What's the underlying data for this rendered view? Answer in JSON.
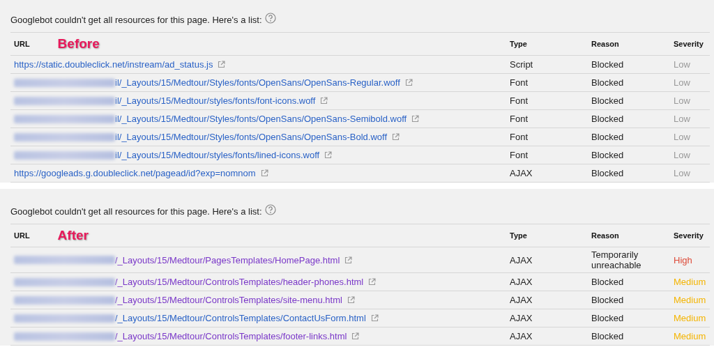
{
  "panels": [
    {
      "intro": "Googlebot couldn't get all resources for this page. Here's a list:",
      "annotation": "Before",
      "columns": [
        "URL",
        "Type",
        "Reason",
        "Severity"
      ],
      "rows": [
        {
          "redacted": false,
          "url": "https://static.doubleclick.net/instream/ad_status.js",
          "visited": false,
          "type": "Script",
          "reason": "Blocked",
          "severity": "Low",
          "color": "#999999"
        },
        {
          "redacted": true,
          "url": "il/_Layouts/15/Medtour/Styles/fonts/OpenSans/OpenSans-Regular.woff",
          "visited": false,
          "type": "Font",
          "reason": "Blocked",
          "severity": "Low",
          "color": "#999999"
        },
        {
          "redacted": true,
          "url": "il/_Layouts/15/Medtour/styles/fonts/font-icons.woff",
          "visited": false,
          "type": "Font",
          "reason": "Blocked",
          "severity": "Low",
          "color": "#999999"
        },
        {
          "redacted": true,
          "url": "il/_Layouts/15/Medtour/Styles/fonts/OpenSans/OpenSans-Semibold.woff",
          "visited": false,
          "type": "Font",
          "reason": "Blocked",
          "severity": "Low",
          "color": "#999999"
        },
        {
          "redacted": true,
          "url": "il/_Layouts/15/Medtour/Styles/fonts/OpenSans/OpenSans-Bold.woff",
          "visited": false,
          "type": "Font",
          "reason": "Blocked",
          "severity": "Low",
          "color": "#999999"
        },
        {
          "redacted": true,
          "url": "il/_Layouts/15/Medtour/styles/fonts/lined-icons.woff",
          "visited": false,
          "type": "Font",
          "reason": "Blocked",
          "severity": "Low",
          "color": "#999999"
        },
        {
          "redacted": false,
          "url": "https://googleads.g.doubleclick.net/pagead/id?exp=nomnom",
          "visited": false,
          "type": "AJAX",
          "reason": "Blocked",
          "severity": "Low",
          "color": "#999999"
        }
      ]
    },
    {
      "intro": "Googlebot couldn't get all resources for this page. Here's a list:",
      "annotation": "After",
      "columns": [
        "URL",
        "Type",
        "Reason",
        "Severity"
      ],
      "rows": [
        {
          "redacted": true,
          "url": "/_Layouts/15/Medtour/PagesTemplates/HomePage.html",
          "visited": true,
          "type": "AJAX",
          "reason": "Temporarily unreachable",
          "severity": "High",
          "color": "#dd4b39"
        },
        {
          "redacted": true,
          "url": "/_Layouts/15/Medtour/ControlsTemplates/header-phones.html",
          "visited": true,
          "type": "AJAX",
          "reason": "Blocked",
          "severity": "Medium",
          "color": "#f4b400"
        },
        {
          "redacted": true,
          "url": "/_Layouts/15/Medtour/ControlsTemplates/site-menu.html",
          "visited": true,
          "type": "AJAX",
          "reason": "Blocked",
          "severity": "Medium",
          "color": "#f4b400"
        },
        {
          "redacted": true,
          "url": "/_Layouts/15/Medtour/ControlsTemplates/ContactUsForm.html",
          "visited": false,
          "type": "AJAX",
          "reason": "Blocked",
          "severity": "Medium",
          "color": "#f4b400"
        },
        {
          "redacted": true,
          "url": "/_Layouts/15/Medtour/ControlsTemplates/footer-links.html",
          "visited": true,
          "type": "AJAX",
          "reason": "Blocked",
          "severity": "Medium",
          "color": "#f4b400"
        }
      ]
    }
  ]
}
